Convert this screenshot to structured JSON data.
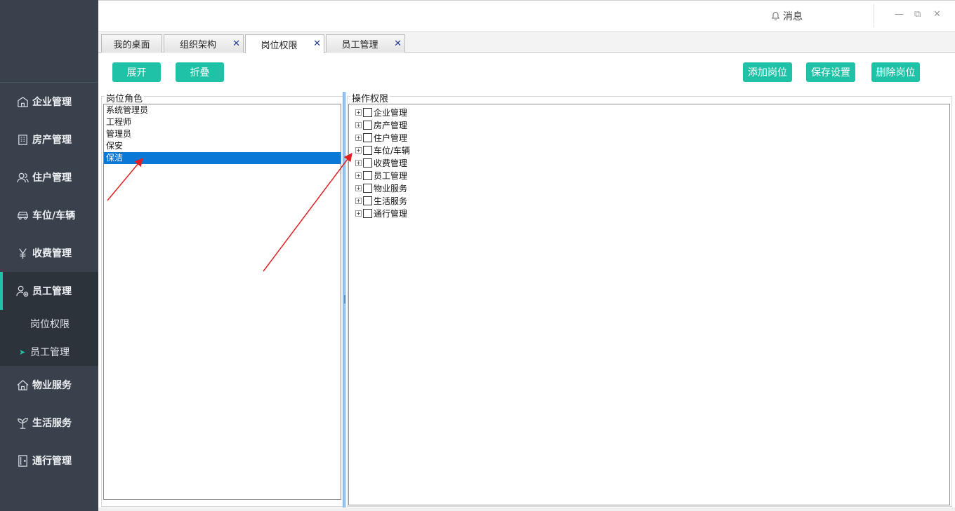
{
  "sidebar": {
    "items": [
      {
        "label": "企业管理",
        "icon": "enterprise-icon"
      },
      {
        "label": "房产管理",
        "icon": "building-icon"
      },
      {
        "label": "住户管理",
        "icon": "residents-icon"
      },
      {
        "label": "车位/车辆",
        "icon": "car-icon"
      },
      {
        "label": "收费管理",
        "icon": "yen-icon"
      },
      {
        "label": "员工管理",
        "icon": "staff-icon",
        "active": true
      },
      {
        "label": "物业服务",
        "icon": "home-icon"
      },
      {
        "label": "生活服务",
        "icon": "plant-icon"
      },
      {
        "label": "通行管理",
        "icon": "door-icon"
      }
    ],
    "sub_items": [
      {
        "label": "岗位权限"
      },
      {
        "label": "员工管理",
        "current": true
      }
    ]
  },
  "topbar": {
    "message_label": "消息",
    "minimize": "—",
    "restore": "⧉",
    "close": "✕"
  },
  "tabs": [
    {
      "label": "我的桌面",
      "closable": false
    },
    {
      "label": "组织架构",
      "closable": true
    },
    {
      "label": "岗位权限",
      "closable": true,
      "active": true
    },
    {
      "label": "员工管理",
      "closable": true
    }
  ],
  "tab_close_glyph": "✕",
  "toolbar": {
    "expand_label": "展开",
    "collapse_label": "折叠",
    "add_label": "添加岗位",
    "save_label": "保存设置",
    "delete_label": "删除岗位"
  },
  "roles_panel": {
    "title": "岗位角色",
    "roles": [
      "系统管理员",
      "工程师",
      "管理员",
      "保安",
      "保洁"
    ],
    "selected": "保洁"
  },
  "permissions_panel": {
    "title": "操作权限",
    "items": [
      "企业管理",
      "房产管理",
      "住户管理",
      "车位/车辆",
      "收费管理",
      "员工管理",
      "物业服务",
      "生活服务",
      "通行管理"
    ]
  },
  "colors": {
    "accent": "#1fc2a7",
    "sidebar_bg": "#39424c",
    "selection": "#0a78d7",
    "annotation_arrow": "#e02020"
  }
}
